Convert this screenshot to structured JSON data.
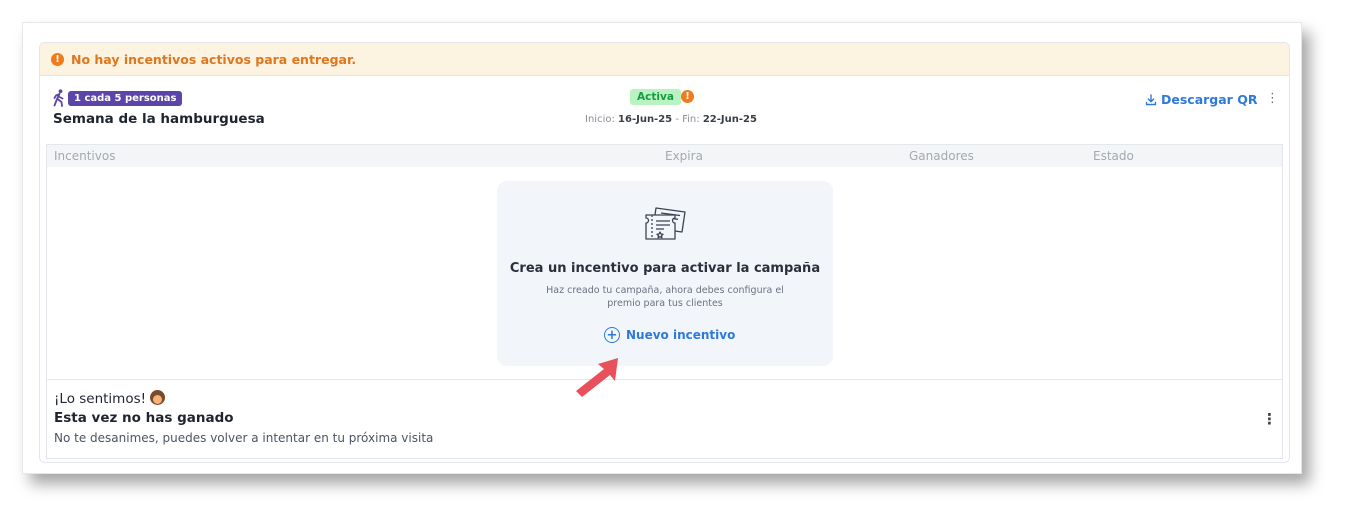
{
  "alert": {
    "text": "No hay incentivos activos para entregar.",
    "icon": "!"
  },
  "campaign": {
    "ratio_badge": "1 cada 5 personas",
    "title": "Semana de la hamburguesa",
    "status": "Activa",
    "warning_icon": "!",
    "start_label": "Inicio:",
    "start_date": "16-Jun-25",
    "separator": "-",
    "end_label": "Fin:",
    "end_date": "22-Jun-25",
    "download_qr": "Descargar QR",
    "menu_icon": "⋮"
  },
  "table": {
    "columns": [
      "Incentivos",
      "Expira",
      "Ganadores",
      "Estado"
    ]
  },
  "empty_state": {
    "icon": "ticket-icon",
    "title": "Crea un incentivo para activar la campaña",
    "subtitle": "Haz creado tu campaña, ahora debes configura el premio para tus clientes",
    "button": "Nuevo incentivo",
    "plus": "+"
  },
  "lose_message": {
    "title": "¡Lo sentimos!",
    "subtitle": "Esta vez no has ganado",
    "text": "No te desanimes, puedes volver a intentar en tu próxima visita",
    "menu_icon": "⋮"
  },
  "colors": {
    "accent": "#2f7ad8",
    "warning": "#ee7c1f",
    "badge_purple": "#5b45a8",
    "active_bg": "#b9f3c1",
    "active_text": "#189a45",
    "pointer_arrow": "#e8505b"
  }
}
